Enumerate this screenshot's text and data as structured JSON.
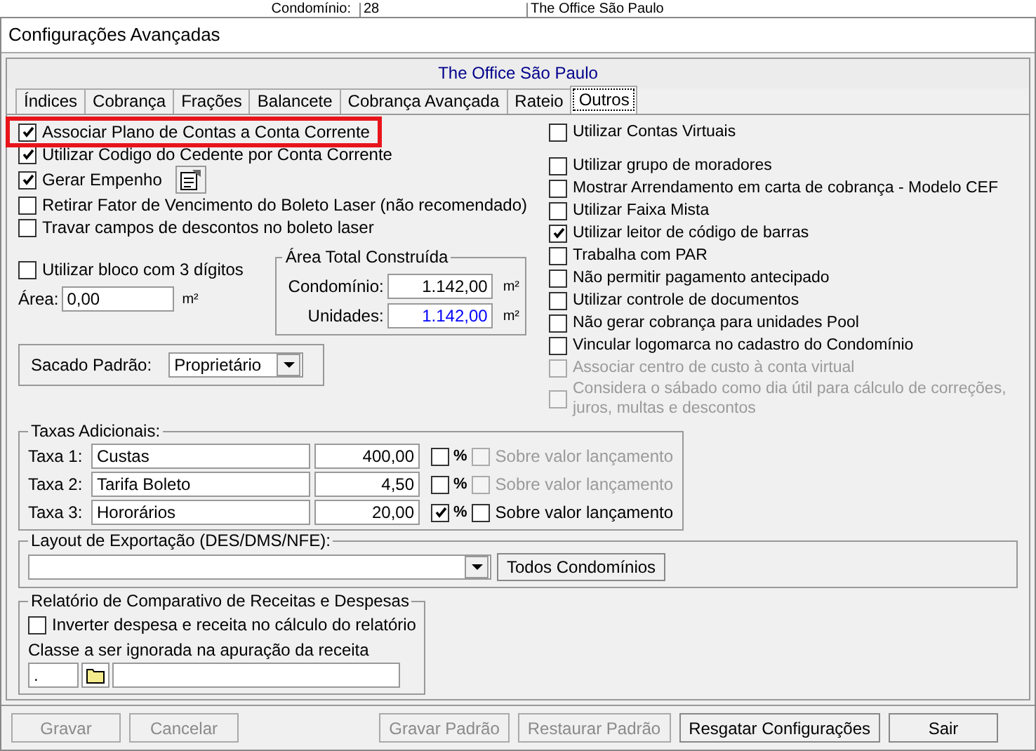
{
  "background_window": {
    "label": "Condomínio:",
    "value": "28",
    "name": "The Office São Paulo"
  },
  "window": {
    "title": "Configurações Avançadas"
  },
  "header": {
    "condominium": "The Office São Paulo"
  },
  "tabs": [
    {
      "label": "Índices",
      "selected": false
    },
    {
      "label": "Cobrança",
      "selected": false
    },
    {
      "label": "Frações",
      "selected": false
    },
    {
      "label": "Balancete",
      "selected": false
    },
    {
      "label": "Cobrança Avançada",
      "selected": false
    },
    {
      "label": "Rateio",
      "selected": false
    },
    {
      "label": "Outros",
      "selected": true
    }
  ],
  "left_options": [
    {
      "kind": "check",
      "label": "Associar Plano de Contas a Conta Corrente",
      "checked": true,
      "highlighted": true
    },
    {
      "kind": "check",
      "label": "Utilizar Codigo do Cedente por Conta Corrente",
      "checked": true,
      "highlighted": false
    },
    {
      "kind": "check_with_button",
      "label": "Gerar Empenho",
      "checked": true,
      "highlighted": false
    },
    {
      "kind": "check",
      "label": "Retirar Fator de Vencimento do Boleto Laser (não recomendado)",
      "checked": false,
      "highlighted": false
    },
    {
      "kind": "check",
      "label": "Travar campos de descontos no boleto laser",
      "checked": false,
      "highlighted": false
    }
  ],
  "block_option": {
    "label": "Utilizar bloco com 3 dígitos",
    "checked": false
  },
  "area": {
    "label": "Área:",
    "value": "0,00",
    "unit": "m²"
  },
  "area_total": {
    "title": "Área Total Construída",
    "rows": [
      {
        "label": "Condomínio:",
        "value": "1.142,00",
        "unit": "m²",
        "color": "#000000"
      },
      {
        "label": "Unidades:",
        "value": "1.142,00",
        "unit": "m²",
        "color": "#0000ff"
      }
    ]
  },
  "sacado": {
    "label": "Sacado Padrão:",
    "value": "Proprietário"
  },
  "right_top_option": {
    "label": "Utilizar Contas Virtuais",
    "checked": false
  },
  "right_options": [
    {
      "label": "Utilizar grupo de moradores",
      "checked": false,
      "disabled": false
    },
    {
      "label": "Mostrar Arrendamento em carta de cobrança - Modelo CEF",
      "checked": false,
      "disabled": false
    },
    {
      "label": "Utilizar Faixa Mista",
      "checked": false,
      "disabled": false
    },
    {
      "label": "Utilizar leitor de código de barras",
      "checked": true,
      "disabled": false
    },
    {
      "label": "Trabalha com PAR",
      "checked": false,
      "disabled": false
    },
    {
      "label": "Não permitir pagamento antecipado",
      "checked": false,
      "disabled": false
    },
    {
      "label": "Utilizar controle de documentos",
      "checked": false,
      "disabled": false
    },
    {
      "label": "Não gerar cobrança para unidades Pool",
      "checked": false,
      "disabled": false
    },
    {
      "label": "Vincular logomarca no cadastro do Condomínio",
      "checked": false,
      "disabled": false
    },
    {
      "label": "Associar centro de custo à conta virtual",
      "checked": false,
      "disabled": true
    },
    {
      "label": "Considera o sábado como dia útil para cálculo de correções, juros, multas e descontos",
      "checked": false,
      "disabled": true
    }
  ],
  "taxas": {
    "title": "Taxas Adicionais:",
    "rows": [
      {
        "label": "Taxa 1:",
        "description": "Custas",
        "value": "400,00",
        "percent": false,
        "percent_label": "%",
        "on_launch": false,
        "on_launch_label": "Sobre valor lançamento",
        "on_launch_disabled": true
      },
      {
        "label": "Taxa 2:",
        "description": "Tarifa Boleto",
        "value": "4,50",
        "percent": false,
        "percent_label": "%",
        "on_launch": false,
        "on_launch_label": "Sobre valor lançamento",
        "on_launch_disabled": true
      },
      {
        "label": "Taxa 3:",
        "description": "Hororários",
        "value": "20,00",
        "percent": true,
        "percent_label": "%",
        "on_launch": false,
        "on_launch_label": "Sobre valor lançamento",
        "on_launch_disabled": false
      }
    ]
  },
  "export_layout": {
    "title": "Layout de Exportação (DES/DMS/NFE):",
    "button": "Todos Condomínios"
  },
  "report": {
    "title": "Relatório de Comparativo de Receitas e Despesas",
    "option": {
      "label": "Inverter despesa e receita no cálculo do relatório",
      "checked": false
    },
    "class_label": "Classe a ser ignorada na apuração da receita",
    "class_code": "."
  },
  "buttons_left": [
    {
      "label": "Gravar",
      "disabled": true
    },
    {
      "label": "Cancelar",
      "disabled": true
    }
  ],
  "buttons_right": [
    {
      "label": "Gravar Padrão",
      "disabled": true
    },
    {
      "label": "Restaurar Padrão",
      "disabled": true
    },
    {
      "label": "Resgatar Configurações",
      "disabled": false
    },
    {
      "label": "Sair",
      "disabled": false
    }
  ]
}
